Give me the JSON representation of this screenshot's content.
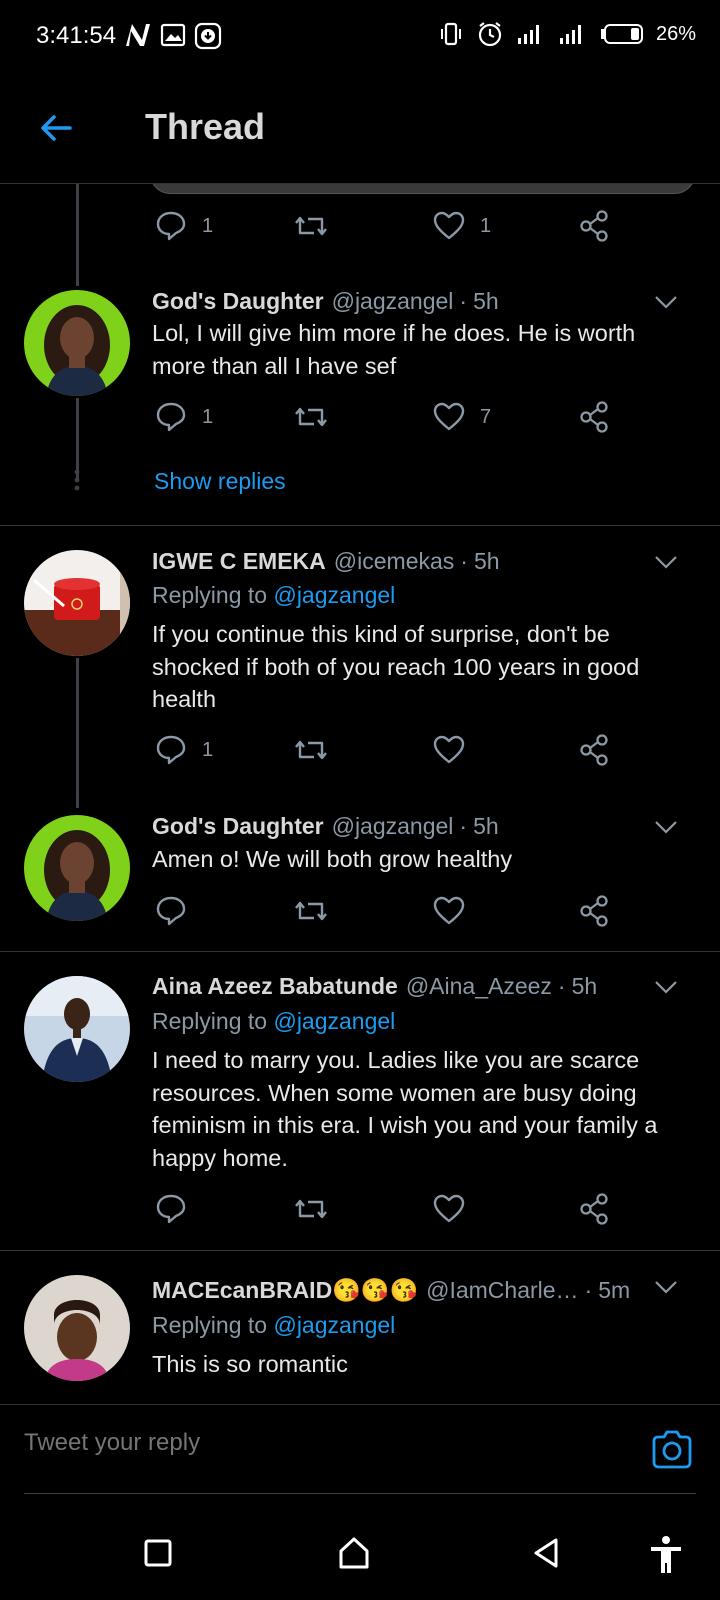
{
  "status_bar": {
    "time": "3:41:54",
    "battery_pct": "26%"
  },
  "header": {
    "title": "Thread"
  },
  "tweets": [
    {
      "name": "",
      "reply_count": "1",
      "retweet_count": "",
      "like_count": "1"
    },
    {
      "name": "God's Daughter",
      "handle": "@jagzangel",
      "time": "5h",
      "text": "Lol, I will give him more if he does. He is worth more than all I have sef",
      "reply_count": "1",
      "like_count": "7",
      "show_replies": "Show replies"
    },
    {
      "name": "IGWE C EMEKA",
      "handle": "@icemekas",
      "time": "5h",
      "replying_label": "Replying to",
      "replying_to": "@jagzangel",
      "text": "If you continue this kind of surprise, don't be shocked if both of you reach 100 years in good health",
      "reply_count": "1",
      "like_count": ""
    },
    {
      "name": "God's Daughter",
      "handle": "@jagzangel",
      "time": "5h",
      "text": "Amen o! We will both grow healthy",
      "reply_count": "",
      "like_count": ""
    },
    {
      "name": "Aina Azeez Babatunde",
      "handle": "@Aina_Azeez",
      "time": "5h",
      "replying_label": "Replying to",
      "replying_to": "@jagzangel",
      "text": "I need to marry you. Ladies like you are scarce resources. When some women are busy doing feminism in this era. I wish you and your family a happy home.",
      "reply_count": "",
      "like_count": ""
    },
    {
      "name": "MACEcanBRAID😘😘😘",
      "handle": "@IamCharle…",
      "time": "5m",
      "replying_label": "Replying to",
      "replying_to": "@jagzangel",
      "text": "This is so romantic"
    }
  ],
  "dot_sep": "·",
  "composer": {
    "placeholder": "Tweet your reply"
  },
  "colors": {
    "accent": "#1d9bf0",
    "background": "#000000",
    "muted": "#8b98a5"
  },
  "icons": {
    "back": "arrow-left-icon",
    "reply": "speech-bubble-icon",
    "retweet": "retweet-icon",
    "like": "heart-icon",
    "share": "share-icon",
    "caret": "chevron-down-icon",
    "camera": "camera-icon"
  }
}
